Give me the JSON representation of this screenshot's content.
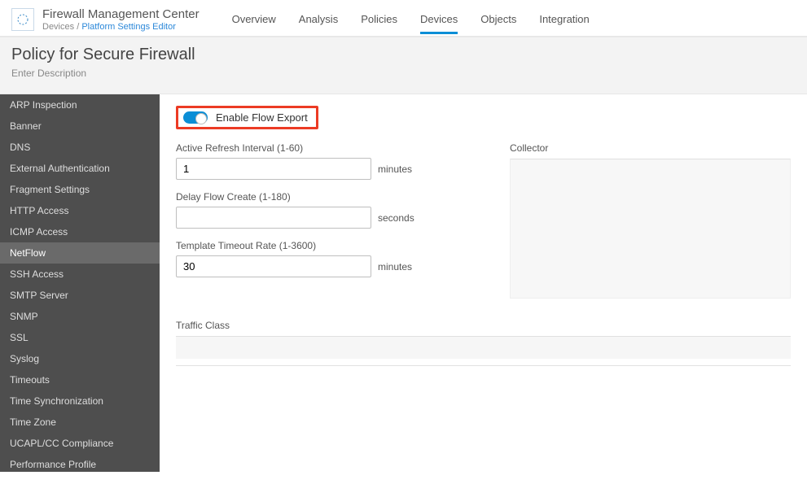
{
  "header": {
    "appTitle": "Firewall Management Center",
    "breadcrumb": {
      "root": "Devices",
      "sep": "/",
      "leaf": "Platform Settings Editor"
    },
    "tabs": [
      {
        "label": "Overview"
      },
      {
        "label": "Analysis"
      },
      {
        "label": "Policies"
      },
      {
        "label": "Devices",
        "active": true
      },
      {
        "label": "Objects"
      },
      {
        "label": "Integration"
      }
    ]
  },
  "subheader": {
    "title": "Policy for Secure Firewall",
    "description": "Enter Description"
  },
  "sidebar": {
    "items": [
      {
        "label": "ARP Inspection"
      },
      {
        "label": "Banner"
      },
      {
        "label": "DNS"
      },
      {
        "label": "External Authentication"
      },
      {
        "label": "Fragment Settings"
      },
      {
        "label": "HTTP Access"
      },
      {
        "label": "ICMP Access"
      },
      {
        "label": "NetFlow",
        "active": true
      },
      {
        "label": "SSH Access"
      },
      {
        "label": "SMTP Server"
      },
      {
        "label": "SNMP"
      },
      {
        "label": "SSL"
      },
      {
        "label": "Syslog"
      },
      {
        "label": "Timeouts"
      },
      {
        "label": "Time Synchronization"
      },
      {
        "label": "Time Zone"
      },
      {
        "label": "UCAPL/CC Compliance"
      },
      {
        "label": "Performance Profile"
      }
    ]
  },
  "main": {
    "toggleLabel": "Enable Flow Export",
    "fields": {
      "activeRefresh": {
        "label": "Active Refresh Interval (1-60)",
        "value": "1",
        "unit": "minutes"
      },
      "delayFlow": {
        "label": "Delay Flow Create (1-180)",
        "value": "",
        "unit": "seconds"
      },
      "templateTimeout": {
        "label": "Template Timeout Rate (1-3600)",
        "value": "30",
        "unit": "minutes"
      }
    },
    "collectorLabel": "Collector",
    "trafficClassLabel": "Traffic Class"
  }
}
